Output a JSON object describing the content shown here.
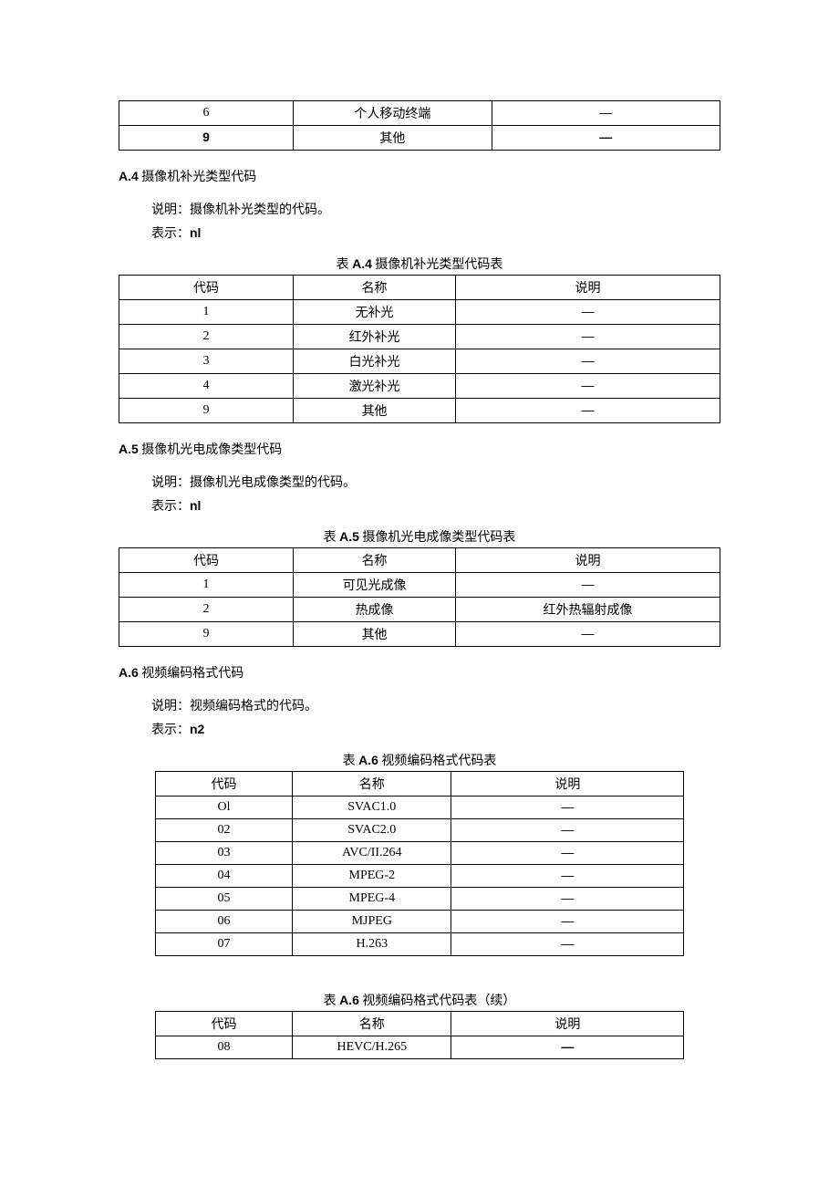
{
  "top_table": {
    "rows": [
      {
        "code": "6",
        "name": "个人移动终端",
        "desc": "—"
      },
      {
        "code": "9",
        "name": "其他",
        "desc": "—"
      }
    ]
  },
  "sections": {
    "a4": {
      "prefix": "A.4",
      "title": " 摄像机补光类型代码",
      "desc": "说明：摄像机补光类型的代码。",
      "repr_label": "表示：",
      "repr_value": "nl",
      "caption_prefix": "表 ",
      "caption_bold": "A.4",
      "caption_suffix": " 摄像机补光类型代码表",
      "headers": {
        "code": "代码",
        "name": "名称",
        "desc": "说明"
      },
      "rows": [
        {
          "code": "1",
          "name": "无补光",
          "desc": "—"
        },
        {
          "code": "2",
          "name": "红外补光",
          "desc": "—"
        },
        {
          "code": "3",
          "name": "白光补光",
          "desc": "—"
        },
        {
          "code": "4",
          "name": "激光补光",
          "desc": "—"
        },
        {
          "code": "9",
          "name": "其他",
          "desc": "—"
        }
      ]
    },
    "a5": {
      "prefix": "A.5",
      "title": " 摄像机光电成像类型代码",
      "desc": "说明：摄像机光电成像类型的代码。",
      "repr_label": "表示：",
      "repr_value": "nl",
      "caption_prefix": "表 ",
      "caption_bold": "A.5",
      "caption_suffix": " 摄像机光电成像类型代码表",
      "headers": {
        "code": "代码",
        "name": "名称",
        "desc": "说明"
      },
      "rows": [
        {
          "code": "1",
          "name": "可见光成像",
          "desc": "—"
        },
        {
          "code": "2",
          "name": "热成像",
          "desc": "红外热辐射成像"
        },
        {
          "code": "9",
          "name": "其他",
          "desc": "—"
        }
      ]
    },
    "a6": {
      "prefix": "A.6",
      "title": " 视频编码格式代码",
      "desc": "说明：视频编码格式的代码。",
      "repr_label": "表示：",
      "repr_value": "n2",
      "caption_prefix": "表 ",
      "caption_bold": "A.6",
      "caption_suffix": " 视频编码格式代码表",
      "headers": {
        "code": "代码",
        "name": "名称",
        "desc": "说明"
      },
      "rows": [
        {
          "code": "Ol",
          "name": "SVAC1.0",
          "desc": "—"
        },
        {
          "code": "02",
          "name": "SVAC2.0",
          "desc": "—"
        },
        {
          "code": "03",
          "name": "AVC/II.264",
          "desc": "—"
        },
        {
          "code": "04",
          "name": "MPEG-2",
          "desc": "—"
        },
        {
          "code": "05",
          "name": "MPEG-4",
          "desc": "—"
        },
        {
          "code": "06",
          "name": "MJPEG",
          "desc": "—"
        },
        {
          "code": "07",
          "name": "H.263",
          "desc": "—"
        }
      ],
      "cont_caption_prefix": "表 ",
      "cont_caption_bold": "A.6",
      "cont_caption_suffix": " 视频编码格式代码表（续）",
      "cont_rows": [
        {
          "code": "08",
          "name": "HEVC/H.265",
          "desc": "—"
        }
      ]
    }
  }
}
